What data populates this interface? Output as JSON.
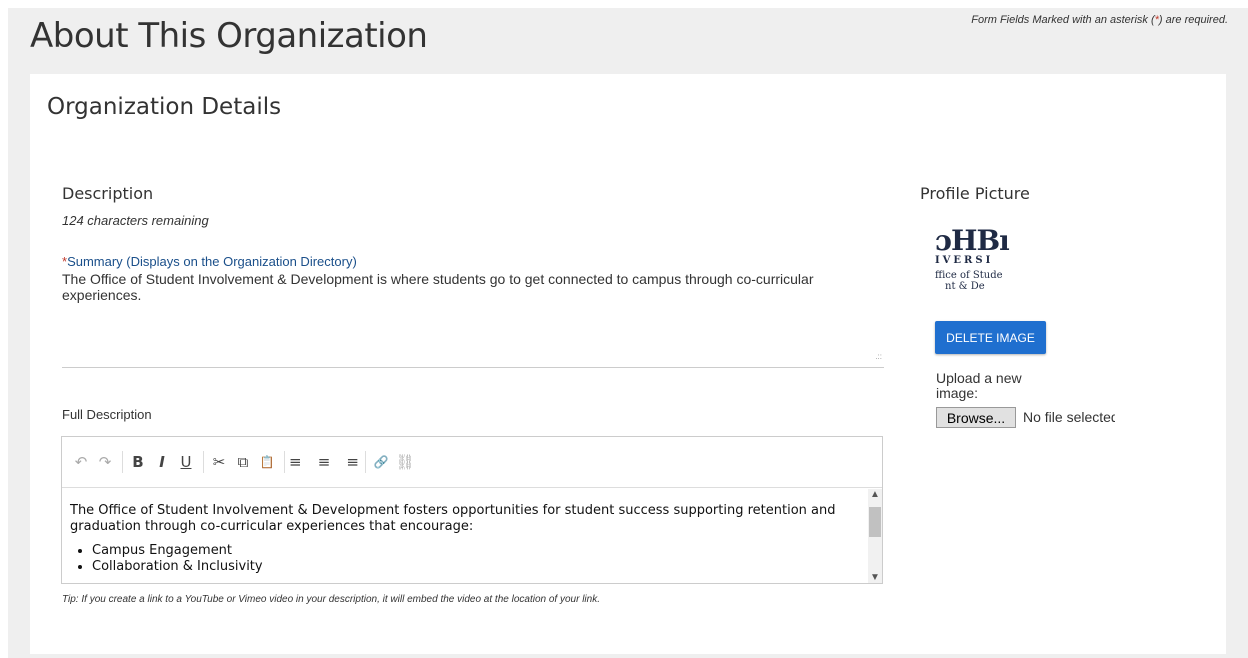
{
  "header": {
    "title": "About This Organization",
    "required_prefix": "Form Fields Marked with an asterisk (",
    "required_asterisk": "*",
    "required_suffix": ") are required."
  },
  "panel": {
    "title": "Organization Details"
  },
  "description": {
    "heading": "Description",
    "chars_remaining": "124 characters remaining",
    "summary_asterisk": "*",
    "summary_label": "Summary (Displays on the Organization Directory)",
    "summary_value": "The Office of Student Involvement & Development is where students go to get connected to campus through co-curricular experiences."
  },
  "full_description": {
    "label": "Full Description",
    "toolbar": {
      "undo": "↶",
      "redo": "↷",
      "bold": "B",
      "italic": "I",
      "underline": "U",
      "cut": "✂",
      "copy": "⧉",
      "paste": "📋",
      "align_left": "≡",
      "align_center": "≡",
      "align_right": "≡",
      "link": "🔗",
      "unlink": "⛓"
    },
    "body_paragraph": "The Office of Student Involvement & Development fosters opportunities for student success supporting retention and graduation through co-curricular experiences that encourage:",
    "bullets": [
      "Campus Engagement",
      "Collaboration & Inclusivity"
    ],
    "tip": "Tip: If you create a link to a YouTube or Vimeo video in your description, it will embed the video at the location of your link."
  },
  "profile_picture": {
    "heading": "Profile Picture",
    "logo_line1": "ɔHBı",
    "logo_line2": "IVERSI",
    "logo_line3": "ffice of Stude",
    "logo_line4": "nt & De",
    "delete_label": "DELETE IMAGE",
    "upload_label": "Upload a new image:",
    "browse_label": "Browse...",
    "file_status": "No file selected."
  },
  "icons": {
    "undo": "undo-icon",
    "redo": "redo-icon",
    "cut": "cut-icon",
    "copy": "copy-icon",
    "paste": "paste-icon",
    "link": "link-icon",
    "unlink": "unlink-icon"
  },
  "colors": {
    "primary_button": "#1f6fcf",
    "label_blue": "#1a4f8a",
    "asterisk_red": "#c0392b"
  }
}
